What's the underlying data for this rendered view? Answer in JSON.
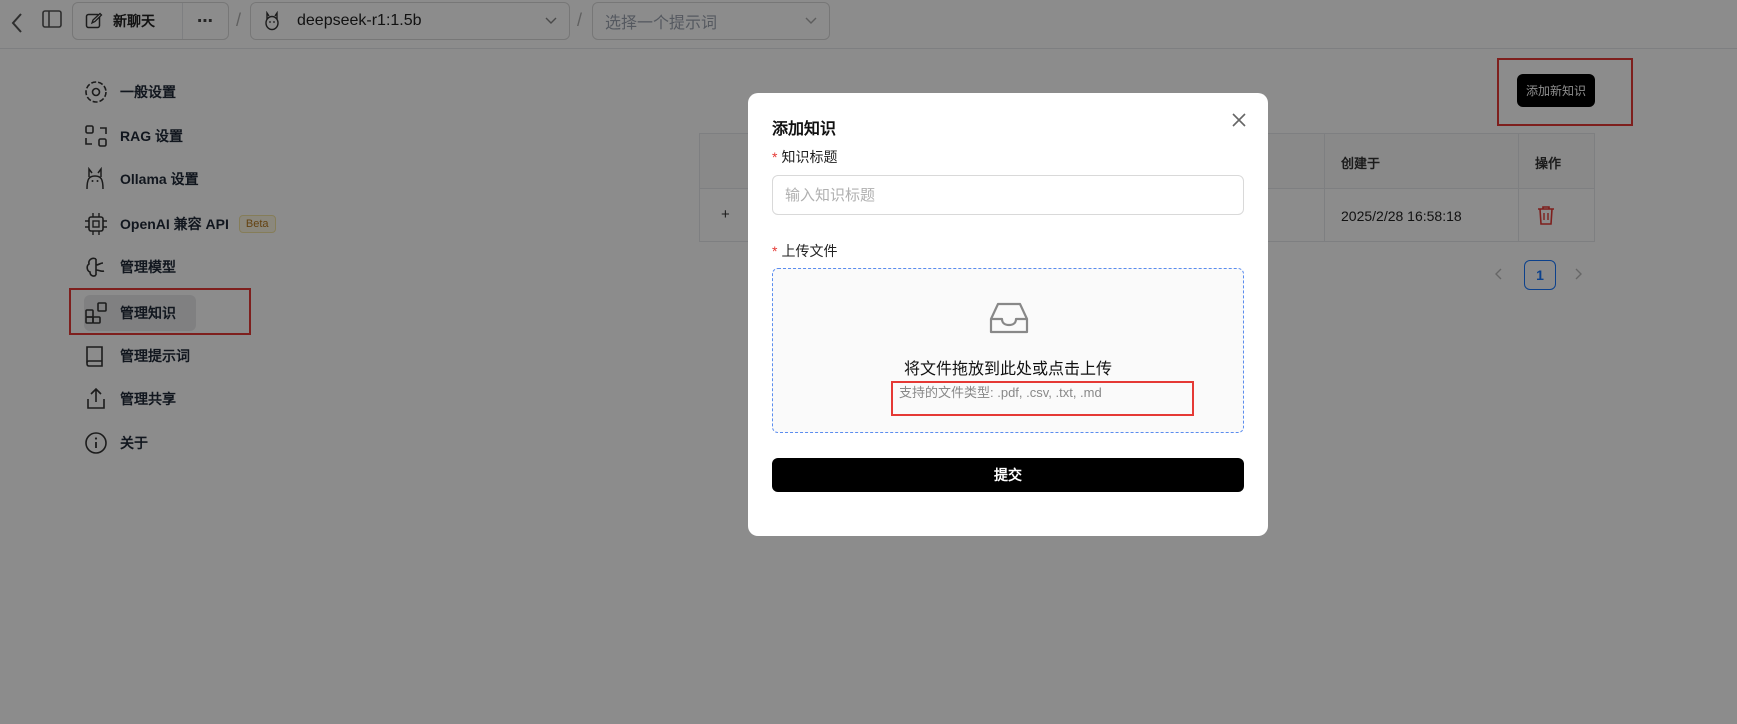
{
  "topbar": {
    "new_chat_label": "新聊天",
    "model_name": "deepseek-r1:1.5b",
    "prompt_placeholder": "选择一个提示词",
    "separator": "/"
  },
  "sidebar": {
    "items": [
      {
        "label": "一般设置",
        "icon": "gear-icon"
      },
      {
        "label": "RAG 设置",
        "icon": "rag-icon"
      },
      {
        "label": "Ollama 设置",
        "icon": "llama-icon"
      },
      {
        "label": "OpenAI 兼容 API",
        "icon": "chip-icon",
        "badge": "Beta"
      },
      {
        "label": "管理模型",
        "icon": "brain-icon"
      },
      {
        "label": "管理知识",
        "icon": "blocks-icon",
        "active": true
      },
      {
        "label": "管理提示词",
        "icon": "book-icon"
      },
      {
        "label": "管理共享",
        "icon": "share-icon"
      },
      {
        "label": "关于",
        "icon": "info-icon"
      }
    ]
  },
  "main": {
    "add_button_label": "添加新知识",
    "table": {
      "headers": {
        "created_at": "创建于",
        "actions": "操作"
      },
      "rows": [
        {
          "expand": "+",
          "created_at": "2025/2/28 16:58:18"
        }
      ]
    },
    "pagination": {
      "current_page": "1"
    }
  },
  "modal": {
    "title": "添加知识",
    "title_field_label": "知识标题",
    "title_field_placeholder": "输入知识标题",
    "upload_label": "上传文件",
    "required_mark": "*",
    "dropzone_text": "将文件拖放到此处或点击上传",
    "supported_types": "支持的文件类型: .pdf, .csv, .txt, .md",
    "submit_label": "提交"
  },
  "colors": {
    "accent": "#1677ff",
    "highlight_box": "#e53935",
    "submit_bg": "#000000",
    "delete_icon": "#e53935"
  }
}
